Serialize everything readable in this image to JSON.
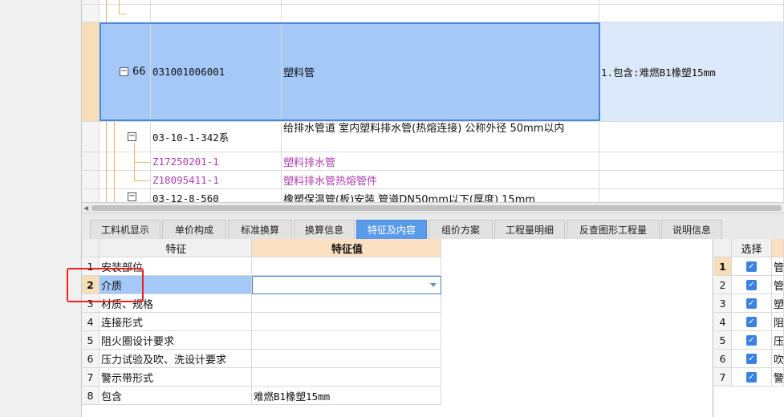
{
  "grid": {
    "rows": [
      {
        "num": "66",
        "code": "031001006001",
        "name": "塑料管",
        "feature": "1.包含:难燃B1橡塑15mm"
      },
      {
        "code": "03-10-1-342系",
        "name": "给排水管道 室内塑料排水管(热熔连接) 公称外径 50mm以内"
      },
      {
        "code": "Z17250201-1",
        "name": "塑料排水管"
      },
      {
        "code": "Z18095411-1",
        "name": "塑料排水管热熔管件"
      },
      {
        "code": "03-12-8-560",
        "name": "橡塑保温管(板)安装 管道DN50mm以下(厚度) 15mm"
      }
    ],
    "collapse_glyph": "−"
  },
  "tabs": [
    "工料机显示",
    "单价构成",
    "标准换算",
    "换算信息",
    "特征及内容",
    "组价方案",
    "工程量明细",
    "反查图形工程量",
    "说明信息"
  ],
  "active_tab": "特征及内容",
  "features": {
    "header": {
      "feature": "特征",
      "value": "特征值"
    },
    "rows": [
      {
        "n": "1",
        "f": "安装部位",
        "v": ""
      },
      {
        "n": "2",
        "f": "介质",
        "v": ""
      },
      {
        "n": "3",
        "f": "材质、规格",
        "v": ""
      },
      {
        "n": "4",
        "f": "连接形式",
        "v": ""
      },
      {
        "n": "5",
        "f": "阻火圈设计要求",
        "v": ""
      },
      {
        "n": "6",
        "f": "压力试验及吹、洗设计要求",
        "v": ""
      },
      {
        "n": "7",
        "f": "警示带形式",
        "v": ""
      },
      {
        "n": "8",
        "f": "包含",
        "v": "难燃B1橡塑15mm"
      }
    ]
  },
  "right_panel": {
    "header": {
      "select": "选择",
      "text": ""
    },
    "rows": [
      {
        "n": "1",
        "t": "管"
      },
      {
        "n": "2",
        "t": "管"
      },
      {
        "n": "3",
        "t": "塑"
      },
      {
        "n": "4",
        "t": "阻"
      },
      {
        "n": "5",
        "t": "压"
      },
      {
        "n": "6",
        "t": "吹"
      },
      {
        "n": "7",
        "t": "警"
      }
    ],
    "check_glyph": "✓"
  },
  "colors": {
    "selection": "#a4c8f8",
    "active_tab": "#5a9bea",
    "highlight_box": "#e8231f",
    "purple_text": "#b03cb0"
  }
}
